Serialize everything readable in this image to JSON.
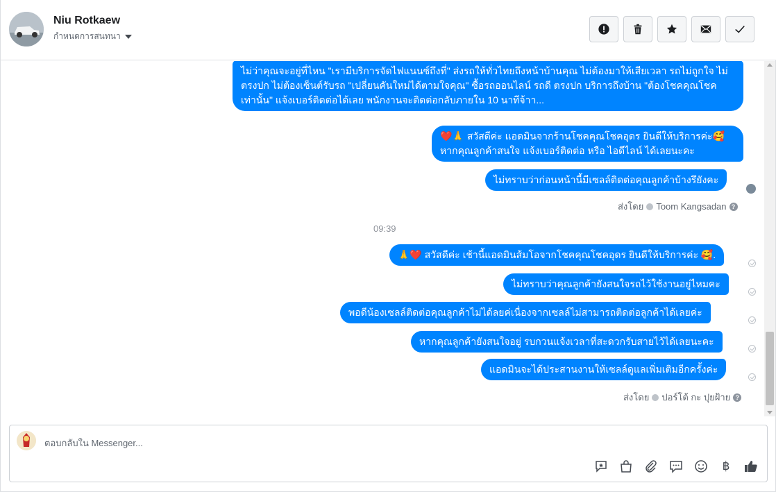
{
  "header": {
    "contact_name": "Niu Rotkaew",
    "assign_label": "กำหนดการสนทนา",
    "actions": [
      "report",
      "delete",
      "star",
      "unread",
      "done"
    ]
  },
  "messages": {
    "m1": "ไม่ว่าคุณจะอยู่ที่ไหน \"เรามีบริการจัดไฟแนนซ์ถึงที่\"  ส่งรถให้ทั่วไทยถึงหน้าบ้านคุณ ไม่ต้องมาให้เสียเวลา รถไม่ถูกใจ ไม่ตรงปก ไม่ต้องเซ็นต์รับรถ \"เปลี่ยนคันใหม่ได้ตามใจคุณ\" ซื้อรถออนไลน์ รถดี ตรงปก บริการถึงบ้าน \"ต้องโชคคุณโชคเท่านั้น\" แจ้งเบอร์ติดต่อได้เลย พนักงานจะติดต่อกลับภายใน 10 นาทีจ้าา...",
    "m2_line1": "❤️🙏 สวัสดีค่ะ แอดมินจากร้านโชคคุณโชคอุดร ยินดีให้บริการค่ะ🥰",
    "m2_line2": "หากคุณลูกค้าสนใจ แจ้งเบอร์ติดต่อ หรือ ไอดีไลน์ ได้เลยนะคะ",
    "m3": "ไม่ทราบว่าก่อนหน้านี้มีเซลล์ติดต่อคุณลูกค้าบ้างรึยังคะ",
    "sent_by_1_prefix": "ส่งโดย",
    "sent_by_1_name": "Toom Kangsadan",
    "time_sep": "09:39",
    "m4": "🙏❤️ สวัสดีค่ะ เช้านี้แอดมินส้มโอจากโชคคุณโชคอุดร ยินดีให้บริการค่ะ 🥰.",
    "m5": "ไม่ทราบว่าคุณลูกค้ายังสนใจรถไว้ใช้งานอยู่ไหมคะ",
    "m6": "พอดีน้องเซลล์ติดต่อคุณลูกค้าไม่ได้ลยค่เนื่องจากเซลล์ไม่สามารถติดต่อลูกค้าได้เลยค่ะ",
    "m7": "หากคุณลูกค้ายังสนใจอยู่ รบกวนแจ้งเวลาที่สะดวกรับสายไว้ได้เลยนะคะ",
    "m8": "แอดมินจะได้ประสานงานให้เซลล์ดูแลเพิ่มเติมอีกครั้งค่ะ",
    "sent_by_2_prefix": "ส่งโดย",
    "sent_by_2_name": "ปอร์โต้ กะ ปุยฝ้าย"
  },
  "composer": {
    "placeholder": "ตอบกลับใน Messenger...",
    "tools": [
      "saved-reply-icon",
      "shopping-bag-icon",
      "attachment-icon",
      "chat-bubble-icon",
      "emoji-icon",
      "baht-icon",
      "like-icon"
    ],
    "baht_symbol": "฿"
  },
  "colors": {
    "bubble": "#0084ff",
    "border": "#dddfe2",
    "muted_text": "#606770"
  }
}
